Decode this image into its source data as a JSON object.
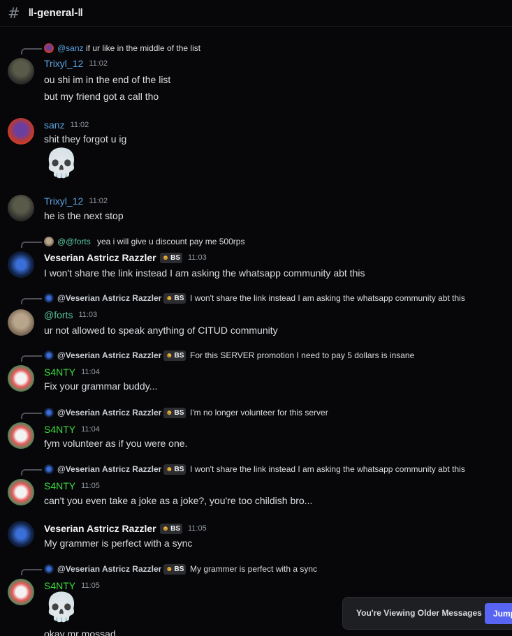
{
  "channel": {
    "hash": "#",
    "name": "‖-general-‖"
  },
  "messages": [
    {
      "reply": {
        "name": "@sanz",
        "text": "if ur like in the middle of the list"
      },
      "author": "Trixyl_12",
      "time": "11:02",
      "lines": [
        "ou shi im in the end of the list",
        "but my friend got a call tho"
      ]
    },
    {
      "author": "sanz",
      "time": "11:02",
      "lines": [
        "shit they forgot u ig"
      ],
      "emoji": "💀"
    },
    {
      "author": "Trixyl_12",
      "time": "11:02",
      "lines": [
        "he is the next stop"
      ]
    },
    {
      "reply": {
        "name": "@@forts",
        "text": "yea i will give u discount pay me 500rps"
      },
      "author": "Veserian Astricz Razzler",
      "badge": "BS",
      "time": "11:03",
      "lines": [
        "I won't share the link instead I am asking the whatsapp community abt this"
      ]
    },
    {
      "reply": {
        "name": "@Veserian Astricz Razzler",
        "badge": "BS",
        "text": "I won't share the link instead I am asking the whatsapp community abt this"
      },
      "author": "@forts",
      "time": "11:03",
      "lines": [
        "ur not allowed to speak anything of CITUD community"
      ]
    },
    {
      "reply": {
        "name": "@Veserian Astricz Razzler",
        "badge": "BS",
        "text": "For this SERVER promotion I need to pay 5 dollars is insane"
      },
      "author": "S4NTY",
      "time": "11:04",
      "lines": [
        "Fix your grammar buddy..."
      ]
    },
    {
      "reply": {
        "name": "@Veserian Astricz Razzler",
        "badge": "BS",
        "text": "I'm no longer volunteer for this server"
      },
      "author": "S4NTY",
      "time": "11:04",
      "lines": [
        "fym volunteer as if you were one."
      ]
    },
    {
      "reply": {
        "name": "@Veserian Astricz Razzler",
        "badge": "BS",
        "text": "I won't share the link instead I am asking the whatsapp community abt this"
      },
      "author": "S4NTY",
      "time": "11:05",
      "lines": [
        "can't you even take a joke as a joke?, you're too childish bro..."
      ]
    },
    {
      "author": "Veserian Astricz Razzler",
      "badge": "BS",
      "time": "11:05",
      "lines": [
        "My grammer is perfect with a sync"
      ]
    },
    {
      "reply": {
        "name": "@Veserian Astricz Razzler",
        "badge": "BS",
        "text": "My grammer is perfect with a sync"
      },
      "author": "S4NTY",
      "time": "11:05",
      "emoji": "💀",
      "lines": [
        "okay mr mossad"
      ]
    }
  ],
  "toast": {
    "text": "You're Viewing Older Messages",
    "button": "Jump"
  },
  "colors": {
    "background": "#070709",
    "blurple": "#5865f2",
    "link": "#5ba3e0",
    "green": "#3ddc3d"
  }
}
